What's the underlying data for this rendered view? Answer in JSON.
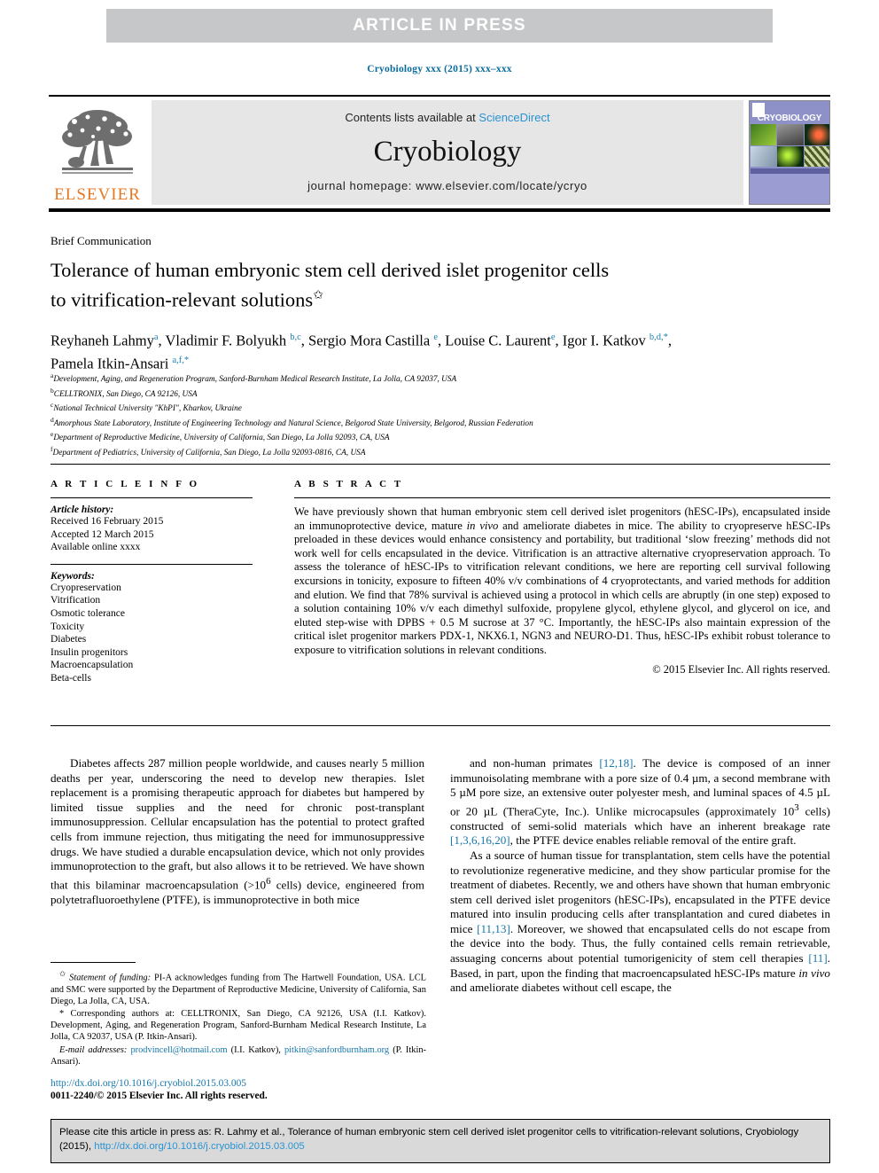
{
  "banner": {
    "text": "ARTICLE  IN  PRESS",
    "bg_color": "#c6c7c9",
    "text_color": "#ffffff"
  },
  "running_head": {
    "text": "Cryobiology xxx (2015) xxx–xxx",
    "color": "#0b6c9c"
  },
  "masthead": {
    "publisher_name": "ELSEVIER",
    "publisher_color": "#e87722",
    "contents_prefix": "Contents lists available at ",
    "contents_link": "ScienceDirect",
    "journal_name": "Cryobiology",
    "homepage": "journal homepage: www.elsevier.com/locate/ycryo",
    "cover_title": "CRYOBIOLOGY",
    "link_color": "#2a93d4"
  },
  "article": {
    "type": "Brief Communication",
    "title_line1": "Tolerance of human embryonic stem cell derived islet progenitor cells",
    "title_line2": "to vitrification-relevant solutions",
    "title_footnote_marker": "✩",
    "authors_html": "Reyhaneh Lahmy<sup>a</sup>, Vladimir F. Bolyukh <sup>b,c</sup>, Sergio Mora Castilla <sup>e</sup>, Louise C. Laurent<sup>e</sup>, Igor I. Katkov <sup>b,d,</sup><sup>*</sup>,<br>Pamela Itkin-Ansari <sup>a,f,</sup><sup>*</sup>",
    "affiliations": [
      {
        "marker": "a",
        "text": "Development, Aging, and Regeneration Program, Sanford-Burnham Medical Research Institute, La Jolla, CA 92037, USA"
      },
      {
        "marker": "b",
        "text": "CELLTRONIX, San Diego, CA 92126, USA"
      },
      {
        "marker": "c",
        "text": "National Technical University \"KhPI\", Kharkov, Ukraine"
      },
      {
        "marker": "d",
        "text": "Amorphous State Laboratory, Institute of Engineering Technology and Natural Science, Belgorod State University, Belgorod, Russian Federation"
      },
      {
        "marker": "e",
        "text": "Department of Reproductive Medicine, University of California, San Diego, La Jolla 92093, CA, USA"
      },
      {
        "marker": "f",
        "text": "Department of Pediatrics, University of California, San Diego, La Jolla 92093-0816, CA, USA"
      }
    ]
  },
  "article_info": {
    "heading": "A R T I C L E   I N F O",
    "history_label": "Article history:",
    "history": [
      "Received 16 February 2015",
      "Accepted 12 March 2015",
      "Available online xxxx"
    ],
    "keywords_label": "Keywords:",
    "keywords": [
      "Cryopreservation",
      "Vitrification",
      "Osmotic tolerance",
      "Toxicity",
      "Diabetes",
      "Insulin progenitors",
      "Macroencapsulation",
      "Beta-cells"
    ]
  },
  "abstract": {
    "heading": "A B S T R A C T",
    "body_html": "We have previously shown that human embryonic stem cell derived islet progenitors (hESC-IPs), encapsulated inside an immunoprotective device, mature <i>in vivo</i> and ameliorate diabetes in mice. The ability to cryopreserve hESC-IPs preloaded in these devices would enhance consistency and portability, but traditional &lsquo;slow freezing&rsquo; methods did not work well for cells encapsulated in the device. Vitrification is an attractive alternative cryopreservation approach. To assess the tolerance of hESC-IPs to vitrification relevant conditions, we here are reporting cell survival following excursions in tonicity, exposure to fifteen 40% v/v combinations of 4 cryoprotectants, and varied methods for addition and elution. We find that 78% survival is achieved using a protocol in which cells are abruptly (in one step) exposed to a solution containing 10% v/v each dimethyl sulfoxide, propylene glycol, ethylene glycol, and glycerol on ice, and eluted step-wise with DPBS + 0.5 M sucrose at 37 &deg;C. Importantly, the hESC-IPs also maintain expression of the critical islet progenitor markers PDX-1, NKX6.1, NGN3 and NEURO-D1. Thus, hESC-IPs exhibit robust tolerance to exposure to vitrification solutions in relevant conditions.",
    "copyright": "© 2015 Elsevier Inc. All rights reserved."
  },
  "body": {
    "left_html": "Diabetes affects 287 million people worldwide, and causes nearly 5 million deaths per year, underscoring the need to develop new therapies. Islet replacement is a promising therapeutic approach for diabetes but hampered by limited tissue supplies and the need for chronic post-transplant immunosuppression. Cellular encapsulation has the potential to protect grafted cells from immune rejection, thus mitigating the need for immunosuppressive drugs. We have studied a durable encapsulation device, which not only provides immunoprotection to the graft, but also allows it to be retrieved. We have shown that this bilaminar macroencapsulation (&gt;10<sup>6</sup> cells) device, engineered from polytetrafluoroethylene (PTFE), is immunoprotective in both mice",
    "right_html_p1": "and non-human primates <span class=\"ref\">[12,18]</span>. The device is composed of an inner immunoisolating membrane with a pore size of 0.4 &micro;m, a second membrane with 5 &micro;M pore size, an extensive outer polyester mesh, and luminal spaces of 4.5 &micro;L or 20 &micro;L (TheraCyte, Inc.). Unlike microcapsules (approximately 10<sup>3</sup> cells) constructed of semi-solid materials which have an inherent breakage rate <span class=\"ref\">[1,3,6,16,20]</span>, the PTFE device enables reliable removal of the entire graft.",
    "right_html_p2": "As a source of human tissue for transplantation, stem cells have the potential to revolutionize regenerative medicine, and they show particular promise for the treatment of diabetes. Recently, we and others have shown that human embryonic stem cell derived islet progenitors (hESC-IPs), encapsulated in the PTFE device matured into insulin producing cells after transplantation and cured diabetes in mice <span class=\"ref\">[11,13]</span>. Moreover, we showed that encapsulated cells do not escape from the device into the body. Thus, the fully contained cells remain retrievable, assuaging concerns about potential tumorigenicity of stem cell therapies <span class=\"ref\">[11]</span>. Based, in part, upon the finding that macroencapsulated hESC-IPs mature <i>in vivo</i> and ameliorate diabetes without cell escape, the"
  },
  "footnotes": {
    "funding_html": "<sup>✩</sup> <i>Statement of funding:</i> PI-A acknowledges funding from The Hartwell Foundation, USA. LCL and SMC were supported by the Department of Reproductive Medicine, University of California, San Diego, La Jolla, CA, USA.",
    "corresponding_html": "* Corresponding authors at: CELLTRONIX, San Diego, CA 92126, USA (I.I. Katkov). Development, Aging, and Regeneration Program, Sanford-Burnham Medical Research Institute, La Jolla, CA 92037, USA (P. Itkin-Ansari).",
    "email_label": "E-mail addresses:",
    "email_1": "prodvincell@hotmail.com",
    "email_1_owner": "(I.I. Katkov),",
    "email_2": "pitkin@sanfordburnham.org",
    "email_2_owner": "(P. Itkin-Ansari)."
  },
  "doi_block": {
    "doi_url": "http://dx.doi.org/10.1016/j.cryobiol.2015.03.005",
    "issn_line": "0011-2240/© 2015 Elsevier Inc. All rights reserved."
  },
  "citation_box": {
    "text_before": "Please cite this article in press as: R. Lahmy et al., Tolerance of human embryonic stem cell derived islet progenitor cells to vitrification-relevant solutions, Cryobiology (2015), ",
    "link": "http://dx.doi.org/10.1016/j.cryobiol.2015.03.005",
    "bg_color": "#d9d9d9"
  }
}
